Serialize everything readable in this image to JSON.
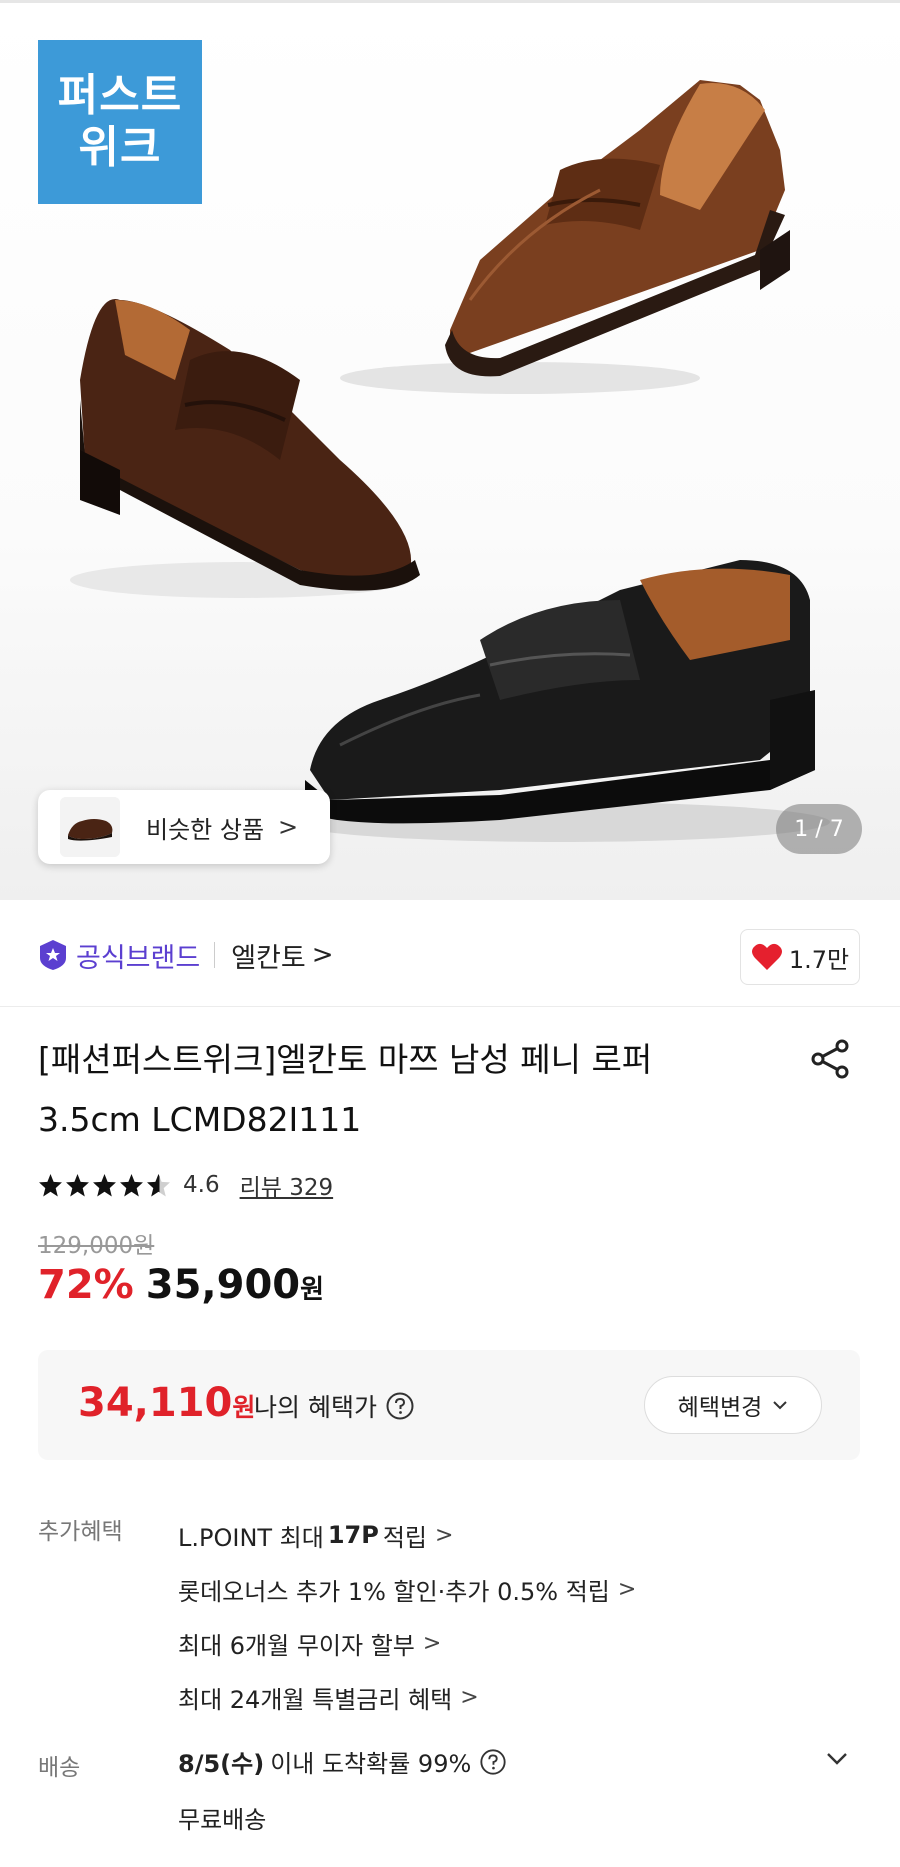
{
  "hero": {
    "promo_badge_line1": "퍼스트",
    "promo_badge_line2": "위크",
    "similar_label": "비슷한 상품",
    "similar_chevron": ">",
    "page_counter": "1 / 7"
  },
  "brand": {
    "official_label": "공식브랜드",
    "name": "엘칸토",
    "chevron": ">",
    "like_count": "1.7만"
  },
  "product": {
    "title_line1": "[패션퍼스트위크]엘칸토 마쯔 남성 페니 로퍼",
    "title_line2": "3.5cm LCMD82I111",
    "rating": 4.6,
    "rating_text": "4.6",
    "review_label": "리뷰 329",
    "original_price": "129,000원",
    "discount": "72%",
    "price": "35,900",
    "price_unit": "원"
  },
  "benefit": {
    "price": "34,110",
    "price_unit": "원",
    "label": "나의 혜택가",
    "change_button": "혜택변경"
  },
  "extra_benefits": {
    "label": "추가혜택",
    "items": [
      {
        "pre": "L.POINT 최대",
        "bold": "17P",
        "post": "적립"
      },
      {
        "pre": "롯데오너스 추가 1% 할인·추가 0.5% 적립",
        "bold": "",
        "post": ""
      },
      {
        "pre": "최대 6개월 무이자 할부",
        "bold": "",
        "post": ""
      },
      {
        "pre": "최대 24개월 특별금리 혜택",
        "bold": "",
        "post": ""
      }
    ],
    "chevron": ">"
  },
  "delivery": {
    "label": "배송",
    "date": "8/5(수)",
    "rest": "이내 도착확률 99%",
    "free": "무료배송"
  },
  "colors": {
    "badge_blue": "#3d9ad8",
    "brand_purple": "#5b3fd0",
    "sale_red": "#e0222a",
    "heart_red": "#e5202e"
  }
}
